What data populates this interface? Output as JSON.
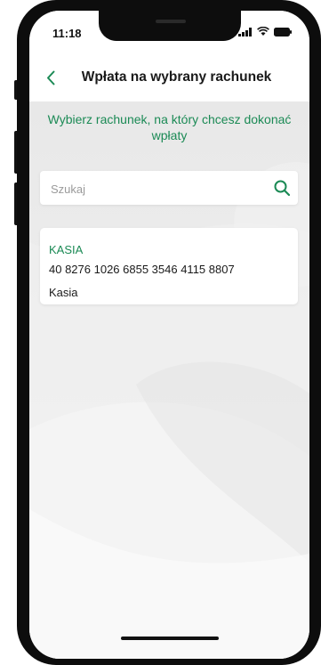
{
  "status_bar": {
    "time": "11:18",
    "icons": [
      "signal-icon",
      "wifi-icon",
      "battery-icon"
    ]
  },
  "header": {
    "back_icon": "chevron-left-icon",
    "title": "Wpłata na wybrany rachunek"
  },
  "instruction": "Wybierz rachunek, na który chcesz dokonać wpłaty",
  "search": {
    "placeholder": "Szukaj",
    "value": "",
    "icon": "search-icon"
  },
  "accounts": [
    {
      "name": "KASIA",
      "number": "40 8276 1026 6855 3546 4115 8807",
      "owner": "Kasia"
    }
  ],
  "colors": {
    "accent": "#1b8a55",
    "text": "#1a1a1a",
    "background": "#ececec"
  }
}
